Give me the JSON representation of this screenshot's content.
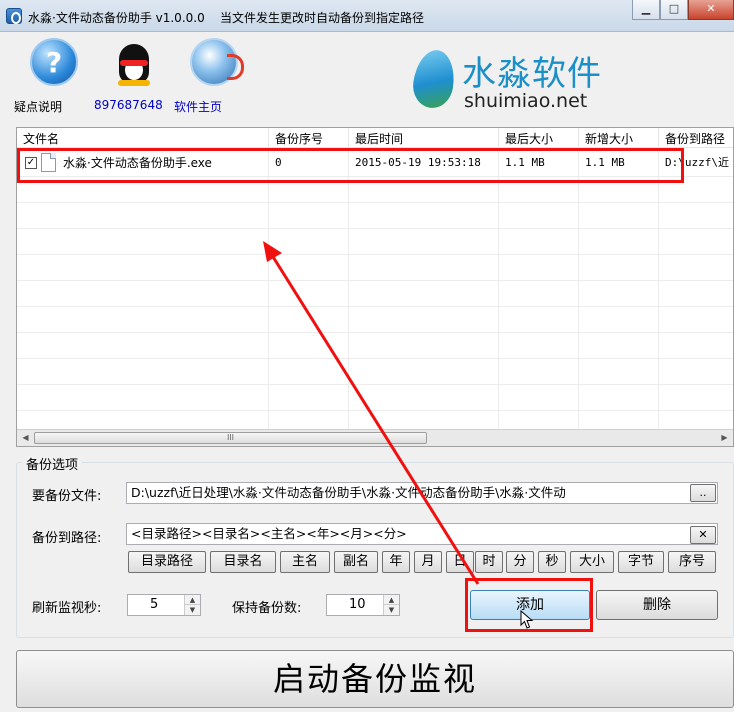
{
  "window": {
    "title": "水淼·文件动态备份助手 v1.0.0.0",
    "subtitle": "当文件发生更改时自动备份到指定路径",
    "minimize_label": "▁",
    "maximize_label": "□",
    "close_label": "✕"
  },
  "toolbar": {
    "help_label": "疑点说明",
    "help_glyph": "?",
    "qq_label": "897687648",
    "website_label": "软件主页"
  },
  "brand": {
    "name_cn": "水淼软件",
    "domain": "shuimiao.net"
  },
  "file_list": {
    "columns": [
      "文件名",
      "备份序号",
      "最后时间",
      "最后大小",
      "新增大小",
      "备份到路径"
    ],
    "rows": [
      {
        "checked": true,
        "check_glyph": "✓",
        "name": "水淼·文件动态备份助手.exe",
        "seq": "0",
        "time": "2015-05-19 19:53:18",
        "last_size": "1.1 MB",
        "added_size": "1.1 MB",
        "path": "D:\\uzzf\\近"
      }
    ],
    "scroll_left": "◀",
    "scroll_right": "▶",
    "scroll_grip": "III"
  },
  "options": {
    "group_title": "备份选项",
    "source_label": "要备份文件:",
    "source_value": "D:\\uzzf\\近日处理\\水淼·文件动态备份助手\\水淼·文件动态备份助手\\水淼·文件动",
    "source_browse": "..",
    "dest_label": "备份到路径:",
    "dest_value": "<目录路径><目录名><主名><年><月><分>",
    "dest_clear": "✕",
    "tags": [
      "目录路径",
      "目录名",
      "主名",
      "副名",
      "年",
      "月",
      "日",
      "时",
      "分",
      "秒",
      "大小",
      "字节",
      "序号"
    ],
    "refresh_label": "刷新监视秒:",
    "refresh_value": "5",
    "keep_label": "保持备份数:",
    "keep_value": "10",
    "spin_up": "▲",
    "spin_down": "▼",
    "add_button": "添加",
    "delete_button": "删除"
  },
  "start_button": "启动备份监视",
  "colors": {
    "annotation": "#f01010",
    "brand_text": "#1b8fc7",
    "link": "#0000c8"
  }
}
